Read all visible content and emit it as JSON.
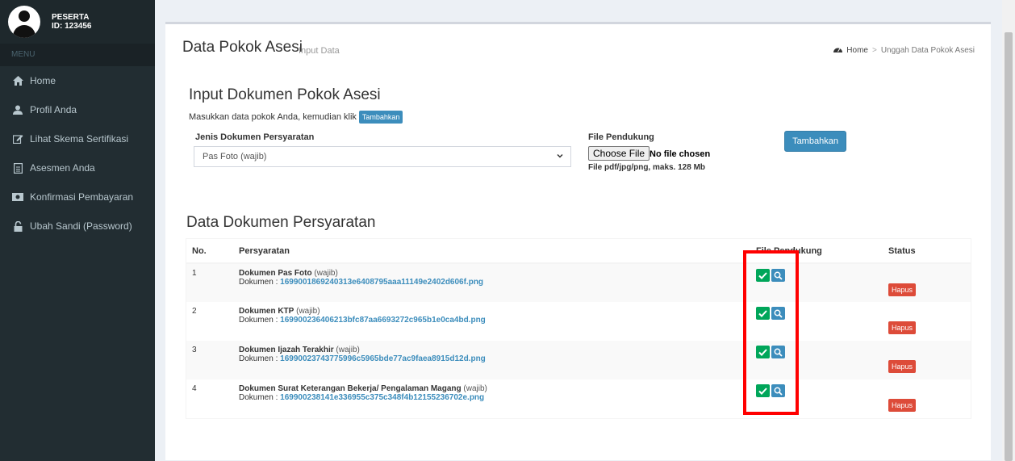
{
  "user": {
    "role": "PESERTA",
    "id": "ID: 123456"
  },
  "sidebar": {
    "menu_header": "MENU",
    "items": [
      {
        "label": "Home",
        "icon": "home-icon"
      },
      {
        "label": "Profil Anda",
        "icon": "user-icon"
      },
      {
        "label": "Lihat Skema Sertifikasi",
        "icon": "edit-icon"
      },
      {
        "label": "Asesmen Anda",
        "icon": "file-icon"
      },
      {
        "label": "Konfirmasi Pembayaran",
        "icon": "money-icon"
      },
      {
        "label": "Ubah Sandi (Password)",
        "icon": "lock-icon"
      }
    ]
  },
  "header": {
    "title": "Data Pokok Asesi",
    "subtitle": "Input Data",
    "breadcrumb": {
      "home": "Home",
      "separator": ">",
      "current": "Unggah Data Pokok Asesi"
    }
  },
  "input_section": {
    "title": "Input Dokumen Pokok Asesi",
    "desc": "Masukkan data pokok Anda, kemudian klik",
    "desc_button": "Tambahkan",
    "jenis_label": "Jenis Dokumen Persyaratan",
    "jenis_selected": "Pas Foto (wajib)",
    "file_label": "File Pendukung",
    "file_button": "Choose File",
    "file_status": "No file chosen",
    "file_note": "File pdf/jpg/png, maks. 128 Mb",
    "submit": "Tambahkan"
  },
  "table_section": {
    "title": "Data Dokumen Persyaratan",
    "headers": [
      "No.",
      "Persyaratan",
      "File Pendukung",
      "Status"
    ],
    "doc_prefix": "Dokumen :",
    "rows": [
      {
        "no": "1",
        "name": "Dokumen Pas Foto",
        "req": "(wajib)",
        "file": "1699001869240313e6408795aaa11149e2402d606f.png",
        "action": "Hapus"
      },
      {
        "no": "2",
        "name": "Dokumen KTP",
        "req": "(wajib)",
        "file": "169900236406213bfc87aa6693272c965b1e0ca4bd.png",
        "action": "Hapus"
      },
      {
        "no": "3",
        "name": "Dokumen Ijazah Terakhir",
        "req": "(wajib)",
        "file": "16990023743775996c5965bde77ac9faea8915d12d.png",
        "action": "Hapus"
      },
      {
        "no": "4",
        "name": "Dokumen Surat Keterangan Bekerja/ Pengalaman Magang",
        "req": "(wajib)",
        "file": "169900238141e336955c375c348f4b12155236702e.png",
        "action": "Hapus"
      }
    ]
  },
  "colors": {
    "sidebar": "#222d32",
    "primary": "#3c8dbc",
    "success": "#00a65a",
    "danger": "#dd4b39",
    "highlight": "#ff0000"
  }
}
